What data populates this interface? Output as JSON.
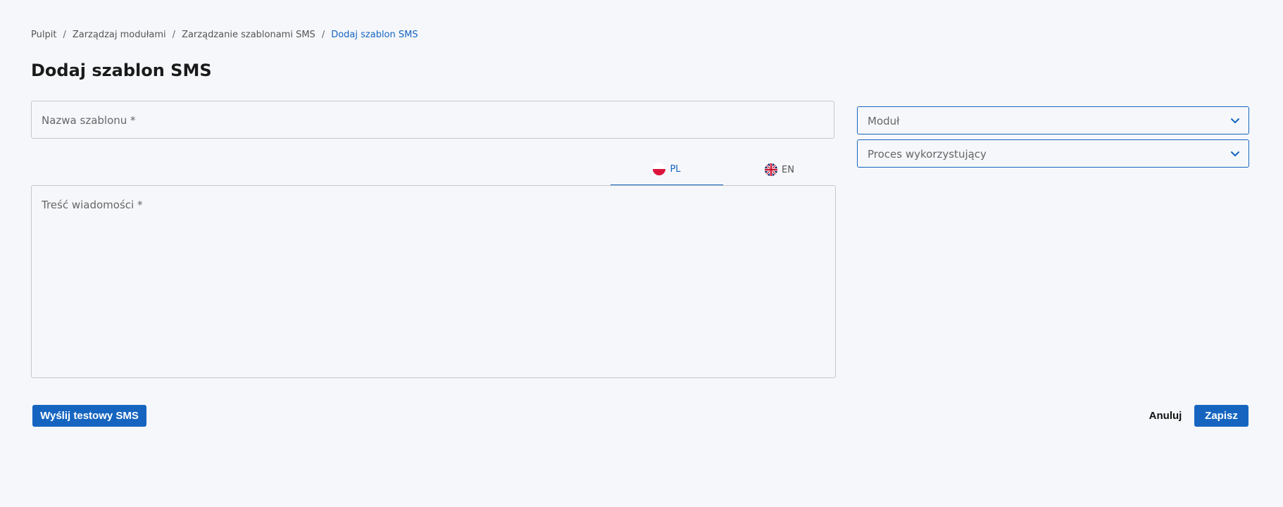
{
  "breadcrumb": {
    "items": [
      "Pulpit",
      "Zarządzaj modułami",
      "Zarządzanie szablonami SMS"
    ],
    "current": "Dodaj szablon SMS",
    "separator": "/"
  },
  "page_title": "Dodaj szablon SMS",
  "form": {
    "name_placeholder": "Nazwa szablonu *",
    "message_placeholder": "Treść wiadomości *",
    "language_tabs": [
      {
        "code": "PL",
        "icon": "poland-flag-icon",
        "active": true
      },
      {
        "code": "EN",
        "icon": "uk-flag-icon",
        "active": false
      }
    ],
    "module_placeholder": "Moduł",
    "process_placeholder": "Proces wykorzystujący"
  },
  "actions": {
    "test_sms_label": "Wyślij testowy SMS",
    "cancel_label": "Anuluj",
    "save_label": "Zapisz"
  },
  "colors": {
    "accent": "#1565c0",
    "background": "#f5f7fa",
    "border": "#c8c8c8"
  }
}
